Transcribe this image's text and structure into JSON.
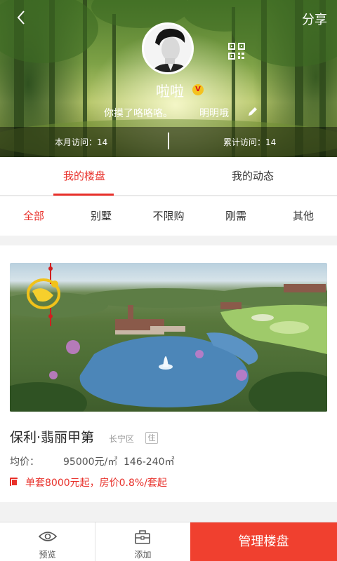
{
  "header": {
    "share_label": "分享",
    "nickname": "啦啦",
    "vip_badge": "V",
    "bio": "你摸了咯咯咯。",
    "bio_name": "明明哦",
    "stats": {
      "month_visits": "本月访问：14",
      "total_visits": "累计访问：14"
    }
  },
  "tabs": [
    {
      "label": "我的楼盘",
      "active": true
    },
    {
      "label": "我的动态",
      "active": false
    }
  ],
  "filters": [
    {
      "label": "全部",
      "active": true
    },
    {
      "label": "别墅",
      "active": false
    },
    {
      "label": "不限购",
      "active": false
    },
    {
      "label": "刚需",
      "active": false
    },
    {
      "label": "其他",
      "active": false
    }
  ],
  "property": {
    "name": "保利·翡丽甲第",
    "district": "长宁区",
    "type_tag": "住",
    "price_label": "均价：",
    "price_value": "95000元/㎡",
    "area_value": "146-240㎡",
    "promo": "单套8000元起，房价0.8%/套起"
  },
  "bottom_bar": {
    "preview_label": "预览",
    "add_label": "添加",
    "manage_label": "管理楼盘"
  },
  "colors": {
    "accent": "#e8302a",
    "manage_button": "#f0402f"
  }
}
